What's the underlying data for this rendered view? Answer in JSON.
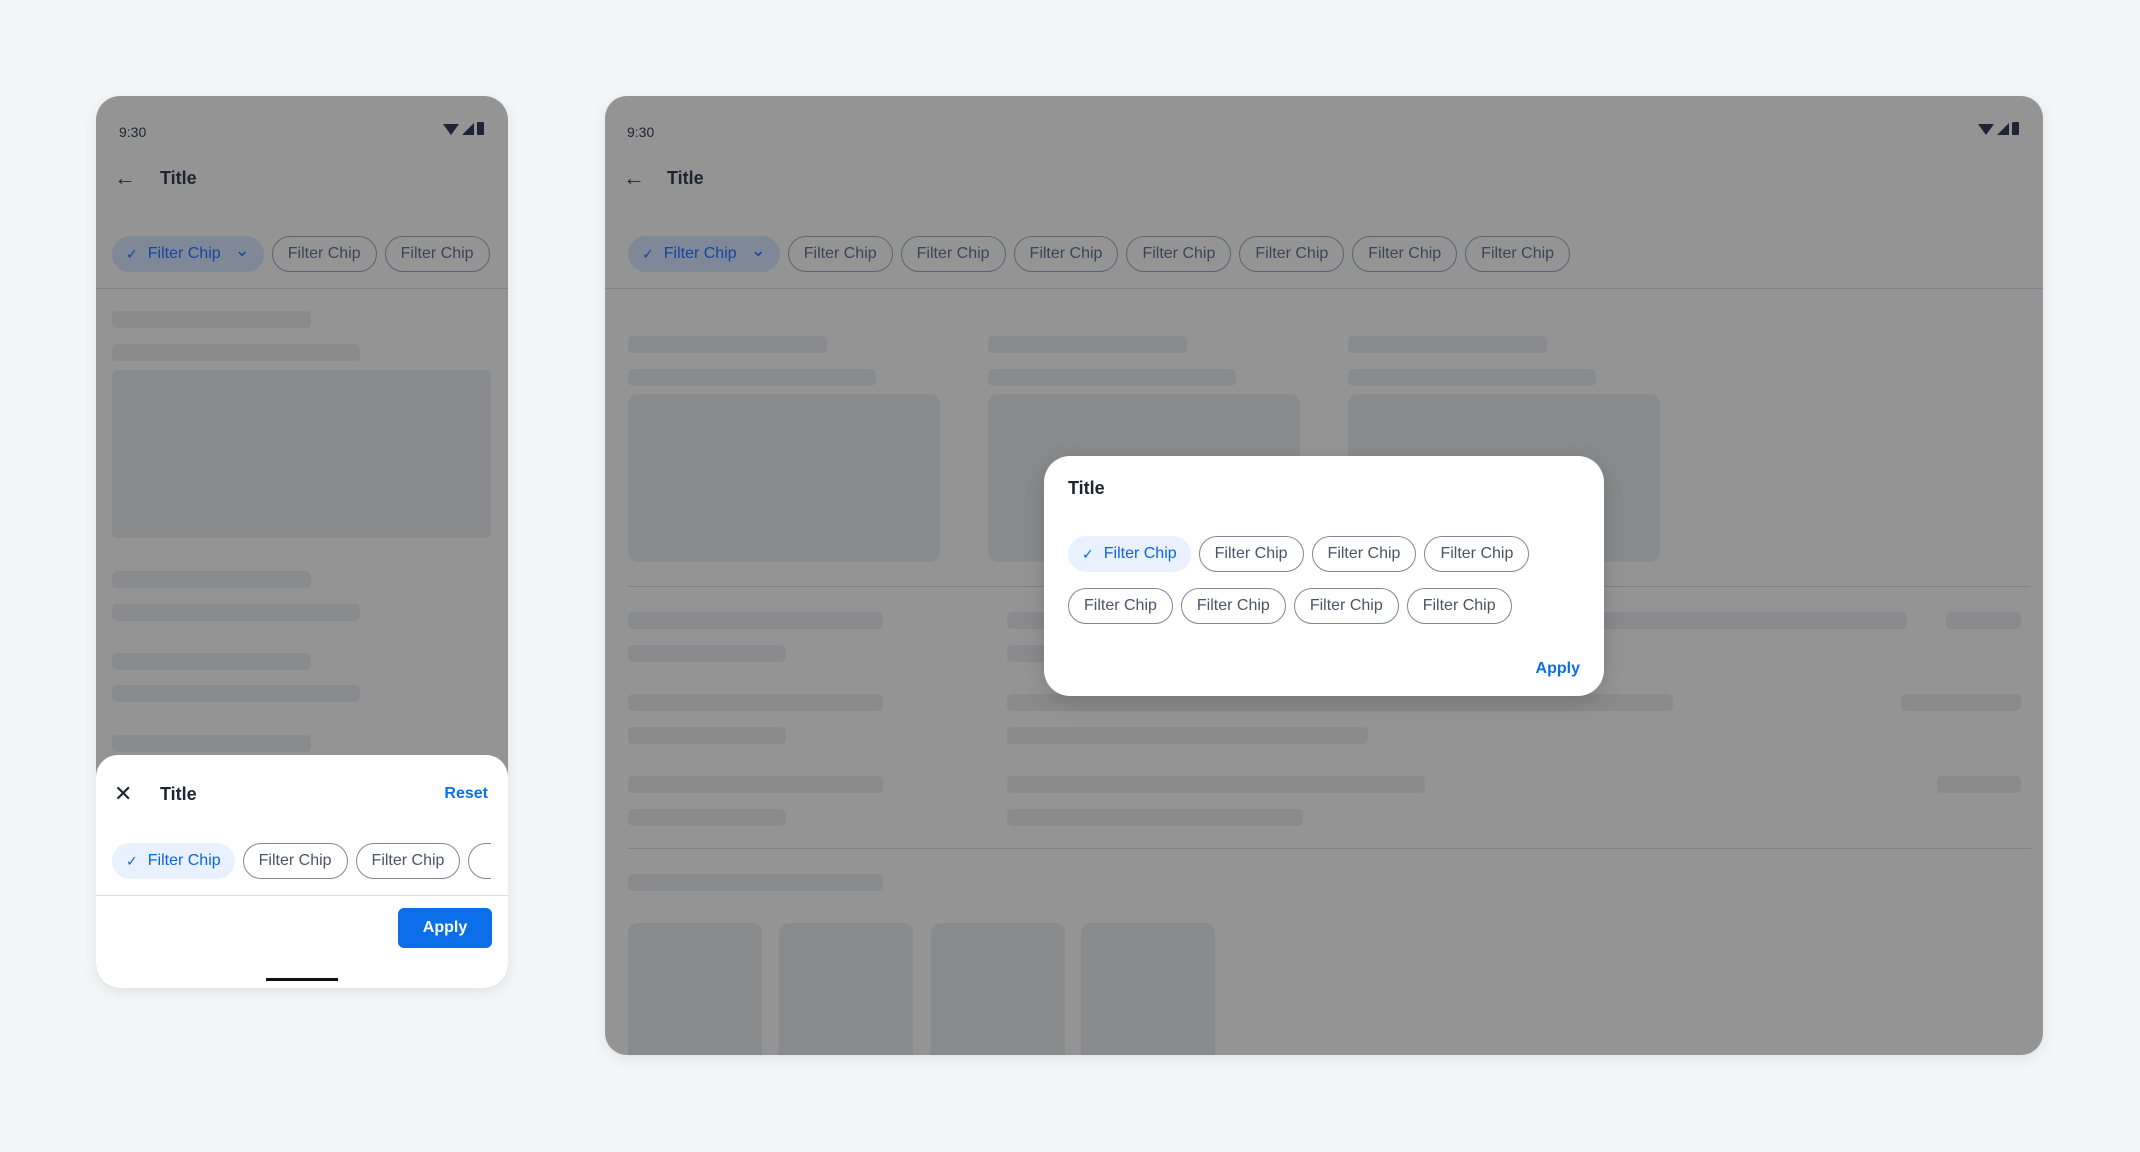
{
  "colors": {
    "accent": "#0a6fe8",
    "selected_chip_bg": "#e8f1fd",
    "scrim": "#949494",
    "page_bg": "#f4f5f7"
  },
  "phone": {
    "status": {
      "time": "9:30",
      "icons": [
        "wifi-icon",
        "signal-icon",
        "battery-icon"
      ]
    },
    "app_bar": {
      "title": "Title",
      "back_icon": "arrow-left-icon"
    },
    "chips": [
      {
        "label": "Filter Chip",
        "selected": true,
        "dropdown": true
      },
      {
        "label": "Filter Chip"
      },
      {
        "label": "Filter Chip"
      }
    ],
    "sheet": {
      "title": "Title",
      "close_icon": "close-icon",
      "reset": "Reset",
      "apply": "Apply",
      "chips": [
        {
          "label": "Filter Chip",
          "selected": true
        },
        {
          "label": "Filter Chip"
        },
        {
          "label": "Filter Chip"
        },
        {
          "label": ""
        }
      ]
    }
  },
  "tablet": {
    "status": {
      "time": "9:30",
      "icons": [
        "wifi-icon",
        "signal-icon",
        "battery-icon"
      ]
    },
    "app_bar": {
      "title": "Title",
      "back_icon": "arrow-left-icon"
    },
    "chips": [
      {
        "label": "Filter Chip",
        "selected": true,
        "dropdown": true
      },
      {
        "label": "Filter Chip"
      },
      {
        "label": "Filter Chip"
      },
      {
        "label": "Filter Chip"
      },
      {
        "label": "Filter Chip"
      },
      {
        "label": "Filter Chip"
      },
      {
        "label": "Filter Chip"
      },
      {
        "label": "Filter Chip"
      }
    ],
    "dialog": {
      "title": "Title",
      "apply": "Apply",
      "rows": [
        [
          {
            "label": "Filter Chip",
            "selected": true
          },
          {
            "label": "Filter Chip"
          },
          {
            "label": "Filter Chip"
          },
          {
            "label": "Filter Chip"
          }
        ],
        [
          {
            "label": "Filter Chip"
          },
          {
            "label": "Filter Chip"
          },
          {
            "label": "Filter Chip"
          },
          {
            "label": "Filter Chip"
          }
        ]
      ]
    }
  }
}
